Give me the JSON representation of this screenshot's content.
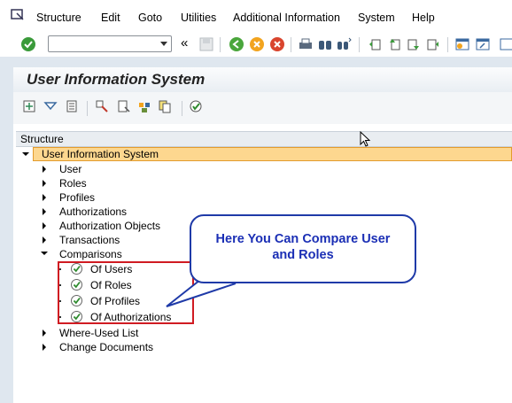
{
  "menu": {
    "items": [
      "Structure",
      "Edit",
      "Goto",
      "Utilities",
      "Additional Information",
      "System",
      "Help"
    ]
  },
  "toolbar": {
    "command_field_value": "",
    "icons": [
      "enter-icon",
      "back-icon",
      "exit-icon",
      "cancel-icon",
      "print-icon",
      "find-icon",
      "find-next-icon",
      "first-page-icon",
      "previous-page-icon",
      "next-page-icon",
      "last-page-icon",
      "create-session-icon",
      "shortcut-icon"
    ]
  },
  "title": "User Information System",
  "app_toolbar": {
    "icons": [
      "expand-subtree-icon",
      "collapse-icon",
      "details-icon",
      "select-icon",
      "documentation-icon",
      "user-menu-icon",
      "copy-icon",
      "execute-icon"
    ]
  },
  "tree": {
    "header": "Structure",
    "root": "User Information System",
    "children": [
      {
        "label": "User",
        "expanded": false
      },
      {
        "label": "Roles",
        "expanded": false
      },
      {
        "label": "Profiles",
        "expanded": false
      },
      {
        "label": "Authorizations",
        "expanded": false
      },
      {
        "label": "Authorization Objects",
        "expanded": false
      },
      {
        "label": "Transactions",
        "expanded": false
      },
      {
        "label": "Comparisons",
        "expanded": true,
        "children": [
          "Of Users",
          "Of Roles",
          "Of Profiles",
          "Of Authorizations"
        ]
      },
      {
        "label": "Where-Used List",
        "expanded": false
      },
      {
        "label": "Change Documents",
        "expanded": false
      }
    ]
  },
  "callout": {
    "line1": "Here You Can Compare User",
    "line2": "and Roles"
  },
  "colors": {
    "highlight_row": "#fdd78f",
    "annotation_border": "#d01b22",
    "callout_text": "#1b2fb5"
  }
}
